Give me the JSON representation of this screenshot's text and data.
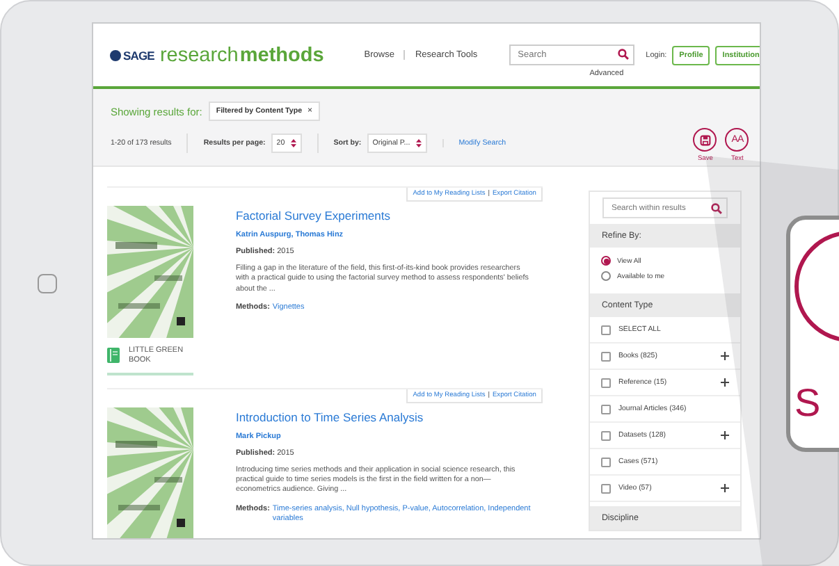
{
  "logo": {
    "brand": "SAGE",
    "word1": "research",
    "word2": "methods"
  },
  "nav": [
    {
      "label": "Browse"
    },
    {
      "label": "Research Tools"
    }
  ],
  "search": {
    "placeholder": "Search",
    "advanced": "Advanced"
  },
  "login": {
    "label": "Login:",
    "buttons": [
      "Profile",
      "Institution"
    ]
  },
  "filter": {
    "label": "Showing results for:",
    "chip": "Filtered by Content Type",
    "chip_close": "×"
  },
  "toolbar": {
    "count": "1-20 of 173 results",
    "per_page_label": "Results per page:",
    "per_page": "20",
    "sort_label": "Sort by:",
    "sort": "Original P...",
    "modify": "Modify Search"
  },
  "tools": [
    {
      "kind": "save",
      "label": "Save"
    },
    {
      "kind": "text",
      "label": "Text",
      "glyph": "AA"
    }
  ],
  "results": [
    {
      "actions": [
        "Add to My Reading Lists",
        "Export Citation"
      ],
      "separator": "|",
      "title": "Factorial Survey Experiments",
      "authors": "Katrin Auspurg, Thomas Hinz",
      "published_label": "Published:",
      "published": "2015",
      "description": "Filling a gap in the literature of the field, this first-of-its-kind book provides researchers with a practical guide to using the factorial survey method to assess respondents' beliefs about the ...",
      "methods_label": "Methods:",
      "methods": "Vignettes",
      "badge": "LITTLE GREEN BOOK"
    },
    {
      "actions": [
        "Add to My Reading Lists",
        "Export Citation"
      ],
      "separator": "|",
      "title": "Introduction to Time Series Analysis",
      "authors": "Mark Pickup",
      "published_label": "Published:",
      "published": "2015",
      "description": "Introducing time series methods and their application in social science research, this practical guide to time series models is the first in the field written for a non—econometrics audience. Giving ...",
      "methods_label": "Methods:",
      "methods": "Time-series analysis, Null hypothesis, P-value, Autocorrelation, Independent variables"
    }
  ],
  "sidebar": {
    "search_placeholder": "Search within results",
    "refine": {
      "title": "Refine By:",
      "options": [
        {
          "label": "View All",
          "selected": true
        },
        {
          "label": "Available to me",
          "selected": false
        }
      ]
    },
    "content_type": {
      "title": "Content Type",
      "items": [
        {
          "label": "SELECT ALL",
          "checked": false,
          "expandable": false
        },
        {
          "label": "Books (825)",
          "checked": false,
          "expandable": true
        },
        {
          "label": "Reference (15)",
          "checked": false,
          "expandable": true
        },
        {
          "label": "Journal Articles (346)",
          "checked": false,
          "expandable": false
        },
        {
          "label": "Datasets (128)",
          "checked": false,
          "expandable": true
        },
        {
          "label": "Cases (571)",
          "checked": false,
          "expandable": false
        },
        {
          "label": "Video (57)",
          "checked": false,
          "expandable": true
        }
      ]
    },
    "discipline": {
      "title": "Discipline"
    }
  },
  "callout": {
    "letter": "S"
  }
}
